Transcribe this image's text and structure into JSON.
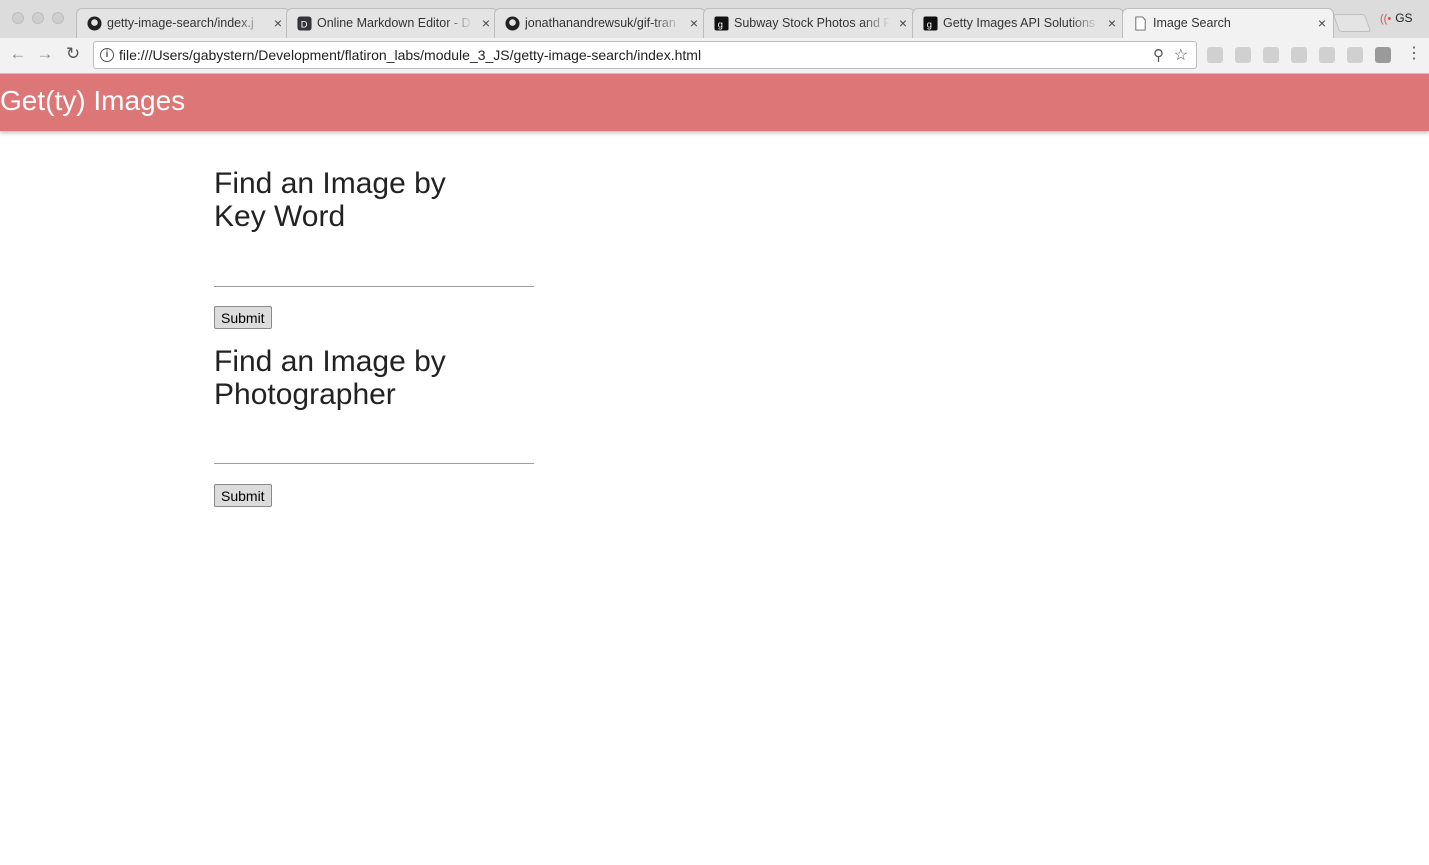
{
  "browser": {
    "tabs": [
      {
        "title": "getty-image-search/index.j",
        "icon": "github-icon"
      },
      {
        "title": "Online Markdown Editor - D",
        "icon": "dillinger-icon"
      },
      {
        "title": "jonathanandrewsuk/gif-tran",
        "icon": "github-icon"
      },
      {
        "title": "Subway Stock Photos and P",
        "icon": "getty-icon"
      },
      {
        "title": "Getty Images API Solutions",
        "icon": "getty-icon"
      },
      {
        "title": "Image Search",
        "icon": "document-icon"
      }
    ],
    "close_glyph": "×",
    "profile_label": "GS",
    "url": "file:///Users/gabystern/Development/flatiron_labs/module_3_JS/getty-image-search/index.html"
  },
  "app": {
    "title": "Get(ty) Images",
    "accent_color": "#dd7676"
  },
  "forms": {
    "keyword": {
      "heading": "Find an Image by Key Word",
      "value": "",
      "submit_label": "Submit"
    },
    "photographer": {
      "heading": "Find an Image by Photographer",
      "value": "",
      "submit_label": "Submit"
    }
  }
}
